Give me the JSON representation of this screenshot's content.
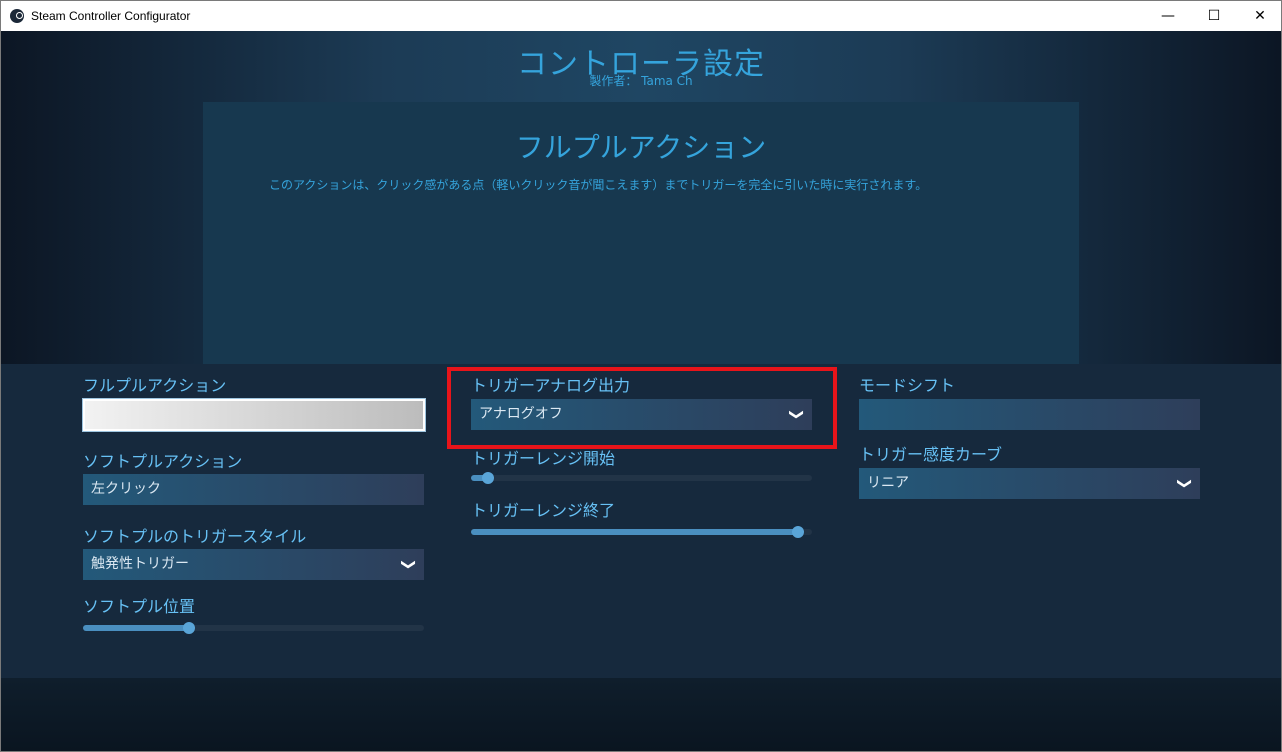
{
  "window": {
    "title": "Steam Controller Configurator",
    "min_glyph": "—",
    "max_glyph": "☐",
    "close_glyph": "✕"
  },
  "header": {
    "title": "コントローラ設定",
    "author": "製作者： Tama Ch"
  },
  "panel": {
    "title": "フルプルアクション",
    "description": "このアクションは、クリック感がある点（軽いクリック音が聞こえます）までトリガーを完全に引いた時に実行されます。"
  },
  "left": {
    "fullpull_label": "フルプルアクション",
    "fullpull_value": "",
    "softpull_label": "ソフトプルアクション",
    "softpull_value": "左クリック",
    "softpull_style_label": "ソフトプルのトリガースタイル",
    "softpull_style_value": "触発性トリガー",
    "softpull_position_label": "ソフトプル位置",
    "softpull_position_level": 0.31
  },
  "middle": {
    "analog_output_label": "トリガーアナログ出力",
    "analog_output_value": "アナログオフ",
    "range_start_label": "トリガーレンジ開始",
    "range_start_level": 0.05,
    "range_end_label": "トリガーレンジ終了",
    "range_end_level": 0.96
  },
  "right": {
    "modeshift_label": "モードシフト",
    "modeshift_value": "",
    "curve_label": "トリガー感度カーブ",
    "curve_value": "リニア"
  },
  "colors": {
    "accent": "#35a4dc",
    "label": "#67c1f5",
    "highlight": "#e8141a"
  },
  "icons": {
    "chevron": "chevron-down-icon",
    "app": "steam-logo-icon"
  }
}
